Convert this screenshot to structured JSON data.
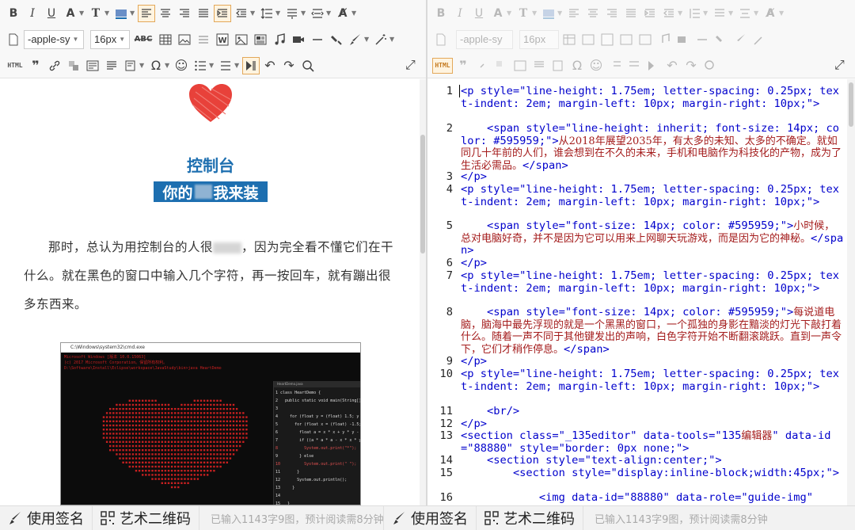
{
  "left_toolbar": {
    "font_family_value": "-apple-sy",
    "font_size_value": "16px",
    "html_label": "HTML"
  },
  "right_toolbar": {
    "font_family_value": "-apple-sy",
    "font_size_value": "16px",
    "html_label": "HTML"
  },
  "article": {
    "title_line1": "控制台",
    "title_line2_a": "你的",
    "title_line2_b": "我来装",
    "paragraph_a": "那时，总认为用控制台的人很",
    "paragraph_b": "，因为完全看不懂它们在干什么。就在黑色的窗口中输入几个字符，再一按回车，就有蹦出很多东西来。"
  },
  "cmd_window": {
    "title": "C:\\Windows\\system32\\cmd.exe",
    "lines": [
      "Microsoft Windows [版本 10.0.15063]",
      "(c) 2017 Microsoft Corporation。保留所有权利。",
      "D:\\Software\\Install\\Eclipse\\workspace\\JavaStudy\\bin>java HeartDemo"
    ],
    "editor_tab": "HeartDemo.java",
    "code_lines": [
      "1 class HeartDemo {",
      "2   public static void main(String[] args) {",
      "3",
      "4     for (float y = (float) 1.5; y > -1.5; y -= 0.1) {",
      "5       for (float x = (float) -1.5; x < 1.5; x += 0.05) {",
      "6         float a = x * x + y * y - 1;",
      "7         if ((a * a * a - x * x * y * y * y) <= 0.0) {",
      "8           System.out.print(\"*\");",
      "9         } else",
      "10          System.out.print(\" \");",
      "11       }",
      "12       System.out.println();",
      "13     }",
      "14",
      "15   }",
      "16 }"
    ]
  },
  "code_lines": [
    {
      "n": "1",
      "text": "<p style=\"line-height: 1.75em; letter-spacing: 0.25px; text-indent: 2em; margin-left: 10px; margin-right: 10px;\">"
    },
    {
      "n": "2",
      "text": "    <span style=\"line-height: inherit; font-size: 14px; color: #595959;\">",
      "zh": "从2018年展望2035年，有太多的未知、太多的不确定。就如同几十年前的人们，谁会想到在不久的未来，手机和电脑作为科技化的产物，成为了生活必需品。",
      "tail": "</span>"
    },
    {
      "n": "3",
      "text": "</p>"
    },
    {
      "n": "4",
      "text": "<p style=\"line-height: 1.75em; letter-spacing: 0.25px; text-indent: 2em; margin-left: 10px; margin-right: 10px;\">"
    },
    {
      "n": "5",
      "text": "    <span style=\"font-size: 14px; color: #595959;\">",
      "zh": "小时候，总对电脑好奇，并不是因为它可以用来上网聊天玩游戏，而是因为它的神秘。",
      "tail": "</span>"
    },
    {
      "n": "6",
      "text": "</p>"
    },
    {
      "n": "7",
      "text": "<p style=\"line-height: 1.75em; letter-spacing: 0.25px; text-indent: 2em; margin-left: 10px; margin-right: 10px;\">"
    },
    {
      "n": "8",
      "text": "    <span style=\"font-size: 14px; color: #595959;\">",
      "zh": "每说道电脑，脑海中最先浮现的就是一个黑黑的窗口，一个孤独的身影在黯淡的灯光下敲打着什么。随着一声不同于其他键发出的声响，白色字符开始不断翻滚跳跃。直到一声令下，它们才稍作停息。",
      "tail": "</span>"
    },
    {
      "n": "9",
      "text": "</p>"
    },
    {
      "n": "10",
      "text": "<p style=\"line-height: 1.75em; letter-spacing: 0.25px; text-indent: 2em; margin-left: 10px; margin-right: 10px;\">"
    },
    {
      "n": "11",
      "text": "    <br/>"
    },
    {
      "n": "12",
      "text": "</p>"
    },
    {
      "n": "13",
      "text": "<section class=\"_135editor\" data-tools=\"135",
      "zh": "编辑器",
      "tail": "\" data-id=\"88880\" style=\"border: 0px none;\">"
    },
    {
      "n": "14",
      "text": "    <section style=\"text-align:center;\">"
    },
    {
      "n": "15",
      "text": "        <section style=\"display:inline-block;width:45px;\">"
    },
    {
      "n": "16",
      "text": "            <img data-id=\"88880\" data-role=\"guide-img\""
    }
  ],
  "bottom_left": {
    "signature_label": "使用签名",
    "qrcode_label": "艺术二维码",
    "status": "已输入1143字9图，预计阅读需8分钟"
  },
  "bottom_right": {
    "signature_label": "使用签名",
    "qrcode_label": "艺术二维码",
    "status": "已输入1143字9图，预计阅读需8分钟"
  },
  "colors": {
    "accent_blue": "#1d6fb0",
    "code_tag": "#0000cc",
    "code_zh": "#a41c1c",
    "heart": "#e8413a"
  }
}
